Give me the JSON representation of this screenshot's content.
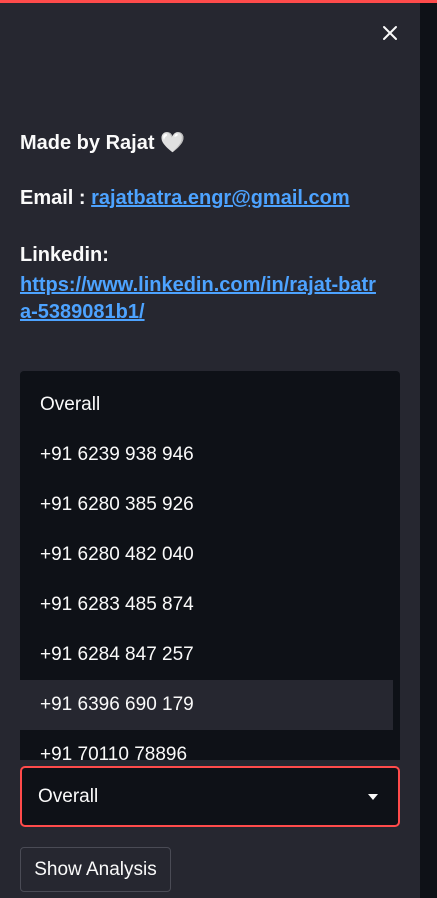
{
  "sidebar": {
    "close_icon": "close-icon",
    "made_by": "Made by Rajat",
    "heart_icon": "🤍",
    "email_label": "Email : ",
    "email_value": "rajatbatra.engr@gmail.com",
    "linkedin_label": "Linkedin:",
    "linkedin_url": "https://www.linkedin.com/in/rajat-batra-5389081b1/"
  },
  "dropdown": {
    "options": [
      "Overall",
      "+91 6239 938 946",
      "+91 6280 385 926",
      "+91 6280 482 040",
      "+91 6283 485 874",
      "+91 6284 847 257",
      "+91 6396 690 179",
      "+91 70110 78896"
    ],
    "highlighted_option": "+91 6396 690 179",
    "selected_value": "Overall"
  },
  "actions": {
    "show_analysis_label": "Show Analysis"
  },
  "colors": {
    "accent": "#ff4b4b",
    "link": "#4da3ff",
    "sidebar_bg": "#262730",
    "main_bg": "#0e1117"
  }
}
